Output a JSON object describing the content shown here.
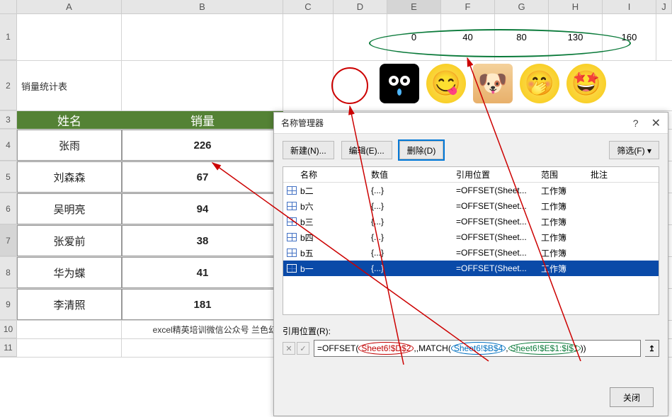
{
  "columns": [
    "A",
    "B",
    "C",
    "D",
    "E",
    "F",
    "G",
    "H",
    "I",
    "J"
  ],
  "row1": {
    "E": "0",
    "F": "40",
    "G": "80",
    "H": "130",
    "I": "160"
  },
  "row2_title": "销量统计表",
  "header": {
    "name": "姓名",
    "sales": "销量"
  },
  "data_rows": [
    {
      "name": "张雨",
      "sales": "226"
    },
    {
      "name": "刘森森",
      "sales": "67"
    },
    {
      "name": "吴明亮",
      "sales": "94"
    },
    {
      "name": "张爱前",
      "sales": "38"
    },
    {
      "name": "华为蝶",
      "sales": "41"
    },
    {
      "name": "李清照",
      "sales": "181"
    }
  ],
  "footnote": "excel精英培训微信公众号 兰色幻",
  "dialog": {
    "title": "名称管理器",
    "buttons": {
      "new": "新建(N)...",
      "edit": "编辑(E)...",
      "delete": "删除(D)",
      "filter": "筛选(F)"
    },
    "cols": {
      "name": "名称",
      "value": "数值",
      "ref": "引用位置",
      "scope": "范围",
      "note": "批注"
    },
    "items": [
      {
        "name": "b二",
        "value": "{...}",
        "ref": "=OFFSET(Sheet...",
        "scope": "工作簿"
      },
      {
        "name": "b六",
        "value": "{...}",
        "ref": "=OFFSET(Sheet...",
        "scope": "工作簿"
      },
      {
        "name": "b三",
        "value": "{...}",
        "ref": "=OFFSET(Sheet...",
        "scope": "工作簿"
      },
      {
        "name": "b四",
        "value": "{...}",
        "ref": "=OFFSET(Sheet...",
        "scope": "工作簿"
      },
      {
        "name": "b五",
        "value": "{...}",
        "ref": "=OFFSET(Sheet...",
        "scope": "工作簿"
      },
      {
        "name": "b一",
        "value": "{...}",
        "ref": "=OFFSET(Sheet...",
        "scope": "工作簿"
      }
    ],
    "ref_label": "引用位置(R):",
    "formula": {
      "p1": "=OFFSET(",
      "seg1": "Sheet6!$D$2",
      "p2": ",,MATCH(",
      "seg2": "Sheet6!$B$4",
      "p3": ",",
      "seg3": "Sheet6!$E$1:$I$1",
      "p4": "))"
    },
    "close": "关闭"
  },
  "emojis": [
    "👀",
    "😋",
    "🐶",
    "🤭",
    "🤩"
  ]
}
